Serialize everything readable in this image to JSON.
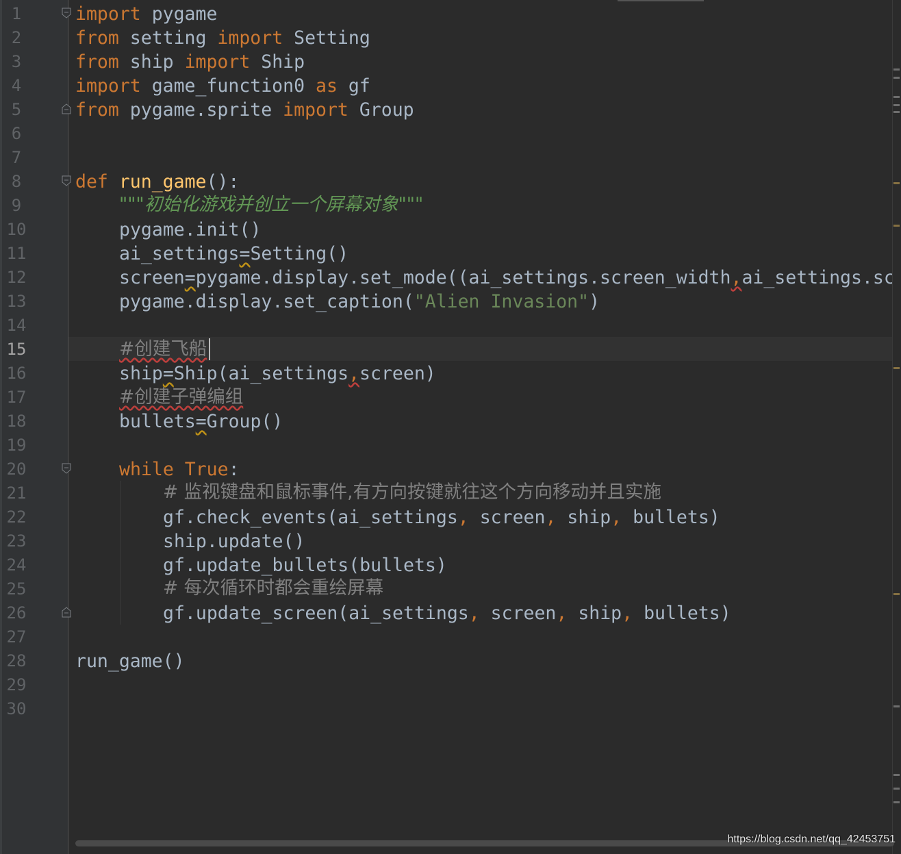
{
  "line_numbers": [
    "1",
    "2",
    "3",
    "4",
    "5",
    "6",
    "7",
    "8",
    "9",
    "10",
    "11",
    "12",
    "13",
    "14",
    "15",
    "16",
    "17",
    "18",
    "19",
    "20",
    "21",
    "22",
    "23",
    "24",
    "25",
    "26",
    "27",
    "28",
    "29",
    "30"
  ],
  "current_line": "15",
  "code": {
    "l1": {
      "kw1": "import",
      "rest": " pygame"
    },
    "l2": {
      "kw1": "from",
      "mod": " setting ",
      "kw2": "import",
      "rest": " Setting"
    },
    "l3": {
      "kw1": "from",
      "mod": " ship ",
      "kw2": "import",
      "rest": " Ship"
    },
    "l4": {
      "kw1": "import",
      "mod": " game_function0 ",
      "kw2": "as",
      "rest": " gf"
    },
    "l5": {
      "kw1": "from",
      "mod": " pygame.sprite ",
      "kw2": "import",
      "rest": " Group"
    },
    "l8": {
      "kw": "def",
      "sp": " ",
      "fn": "run_game",
      "rest": "():"
    },
    "l9": {
      "doc": "\"\"\"初始化游戏并创立一个屏幕对象\"\"\""
    },
    "l10": {
      "text": "pygame.init()"
    },
    "l11": {
      "a": "ai_settings",
      "op": "=",
      "b": "Setting()"
    },
    "l12": {
      "a": "screen",
      "op": "=",
      "b": "pygame.display.set_mode((ai_settings.screen_width",
      "c": ",",
      "d": "ai_settings.screen_height))"
    },
    "l13": {
      "a": "pygame.display.set_caption(",
      "str": "\"Alien Invasion\"",
      "b": ")"
    },
    "l15": {
      "cm": "#创建飞船"
    },
    "l16": {
      "a": "ship",
      "op": "=",
      "b": "Ship(ai_settings",
      "c": ",",
      "d": "screen)"
    },
    "l17": {
      "cm": "#创建子弹编组"
    },
    "l18": {
      "a": "bullets",
      "op": "=",
      "b": "Group()"
    },
    "l20": {
      "kw1": "while",
      "sp": " ",
      "kw2": "True",
      "rest": ":"
    },
    "l21": {
      "cm": "# 监视键盘和鼠标事件,有方向按键就往这个方向移动并且实施"
    },
    "l22": {
      "a": "gf.check_events(ai_settings",
      "c1": ",",
      "b": " screen",
      "c2": ",",
      "d": " ship",
      "c3": ",",
      "e": " bullets)"
    },
    "l23": {
      "text": "ship.update()"
    },
    "l24": {
      "text": "gf.update_bullets(bullets)"
    },
    "l25": {
      "cm": "# 每次循环时都会重绘屏幕"
    },
    "l26": {
      "a": "gf.update_screen(ai_settings",
      "c1": ",",
      "b": " screen",
      "c2": ",",
      "d": " ship",
      "c3": ",",
      "e": " bullets)"
    },
    "l28": {
      "text": "run_game()"
    }
  },
  "watermark": "https://blog.csdn.net/qq_42453751",
  "colors": {
    "background": "#2b2b2b",
    "keyword": "#cc7832",
    "function": "#ffc66d",
    "string": "#6a8759",
    "docstring": "#629755",
    "comment": "#808080",
    "text": "#a9b7c6"
  }
}
